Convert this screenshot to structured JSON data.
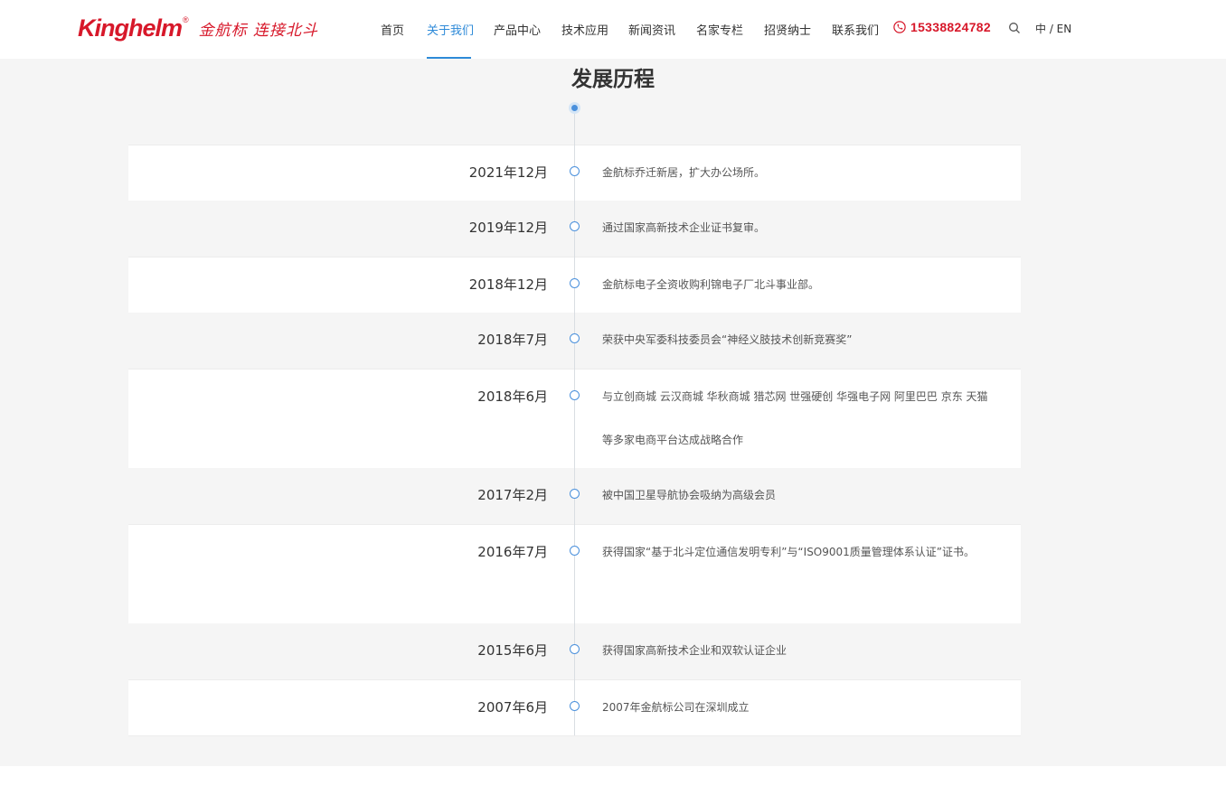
{
  "header": {
    "logo_en": "Kinghelm",
    "logo_reg": "®",
    "logo_cn": "金航标 连接北斗",
    "nav": [
      {
        "label": "首页"
      },
      {
        "label": "关于我们"
      },
      {
        "label": "产品中心"
      },
      {
        "label": "技术应用"
      },
      {
        "label": "新闻资讯"
      },
      {
        "label": "名家专栏"
      },
      {
        "label": "招贤纳士"
      },
      {
        "label": "联系我们"
      }
    ],
    "active_nav": "关于我们",
    "phone": "15338824782",
    "lang": "中 / EN"
  },
  "main": {
    "title": "发展历程",
    "timeline": [
      {
        "date": "2021年12月",
        "text": "金航标乔迁新居，扩大办公场所。"
      },
      {
        "date": "2019年12月",
        "text": "通过国家高新技术企业证书复审。"
      },
      {
        "date": "2018年12月",
        "text": "金航标电子全资收购利锦电子厂北斗事业部。"
      },
      {
        "date": "2018年7月",
        "text": "荣获中央军委科技委员会“神经义肢技术创新竞赛奖”"
      },
      {
        "date": "2018年6月",
        "text": "与立创商城  云汉商城  华秋商城  猎芯网  世强硬创  华强电子网  阿里巴巴  京东  天猫等多家电商平台达成战略合作"
      },
      {
        "date": "2017年2月",
        "text": "被中国卫星导航协会吸纳为高级会员"
      },
      {
        "date": "2016年7月",
        "text": "获得国家“基于北斗定位通信发明专利”与“ISO9001质量管理体系认证”证书。"
      },
      {
        "date": "2015年6月",
        "text": "获得国家高新技术企业和双软认证企业"
      },
      {
        "date": "2007年6月",
        "text": "2007年金航标公司在深圳成立"
      }
    ]
  },
  "colors": {
    "brand_red": "#d7182a",
    "accent_blue": "#2e8ad8",
    "timeline_blue": "#4a90dc",
    "background_grey": "#f5f5f5"
  }
}
